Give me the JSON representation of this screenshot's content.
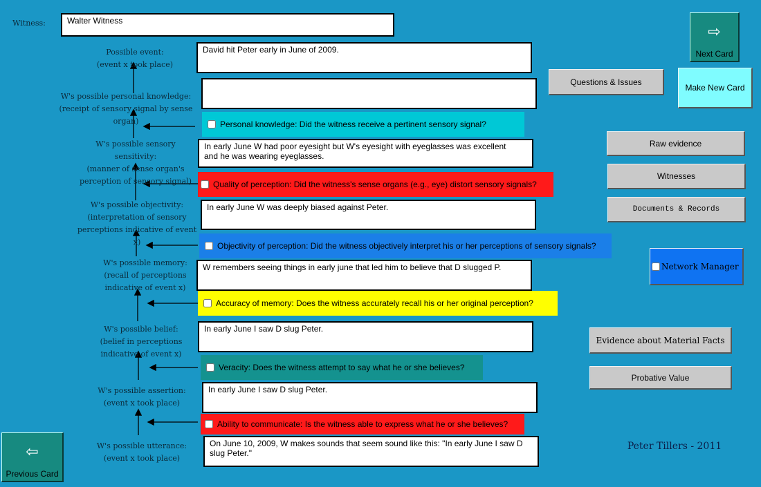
{
  "witness": {
    "label": "Witness:",
    "value": "Walter Witness"
  },
  "levels": [
    {
      "label": "Possible event:\n(event x took place)",
      "value": "David hit Peter early in June of 2009."
    },
    {
      "label": "W's possible personal knowledge:\n(receipt of sensory signal by sense organ)",
      "value": ""
    },
    {
      "label": "W's possible sensory sensitivity:\n(manner of sense organ's\nperception of sensory signal)",
      "value": "In early June W had poor eyesight but W's eyesight with eyeglasses was excellent\nand he was wearing eyeglasses."
    },
    {
      "label": "W's possible objectivity:\n(interpretation of sensory\nperceptions indicative of event x)",
      "value": "In early June W was deeply biased against Peter."
    },
    {
      "label": "W's possible memory:\n(recall of perceptions\nindicative of event x)",
      "value": "W remembers seeing things in early june that led him to believe that D slugged P."
    },
    {
      "label": "W's possible belief:\n(belief in perceptions\nindicative of event x)",
      "value": "In early June I saw D slug Peter."
    },
    {
      "label": "W's possible assertion:\n(event x took place)",
      "value": "In early June I saw D slug Peter."
    },
    {
      "label": "W's possible utterance:\n(event x took place)",
      "value": "On June 10, 2009, W makes sounds that seem sound like this: \"In early June I saw D\nslug Peter.\""
    }
  ],
  "questions": [
    {
      "text": "Personal knowledge: Did the witness receive a pertinent sensory signal?",
      "color": "#00c8d6"
    },
    {
      "text": "Quality of perception:  Did the witness's sense organs (e.g., eye) distort sensory signals?",
      "color": "#ff1a1a"
    },
    {
      "text": "Objectivity of perception: Did the witness objectively interpret his or her perceptions of sensory signals?",
      "color": "#1b7fe8"
    },
    {
      "text": "Accuracy of memory: Does the witness accurately recall his or her original perception?",
      "color": "#ffff00"
    },
    {
      "text": "Veracity: Does the witness attempt to say what he or she believes?",
      "color": "#14928f"
    },
    {
      "text": "Ability to communicate: Is the witness able to express what he or she believes?",
      "color": "#ff1a1a"
    }
  ],
  "buttons": {
    "next_card": "Next Card",
    "previous_card": "Previous Card",
    "questions_issues": "Questions & Issues",
    "make_new_card": "Make New Card",
    "raw_evidence": "Raw evidence",
    "witnesses": "Witnesses",
    "documents_records": "Documents & Records",
    "network_manager": "Network Manager",
    "evidence_material_facts": "Evidence about Material Facts",
    "probative_value": "Probative Value"
  },
  "credit": "Peter Tillers - 2011",
  "colors": {
    "background": "#1a97c6",
    "nav_card": "#178a80",
    "make_new_card": "#7ffcff",
    "network_manager": "#0f73f2"
  }
}
